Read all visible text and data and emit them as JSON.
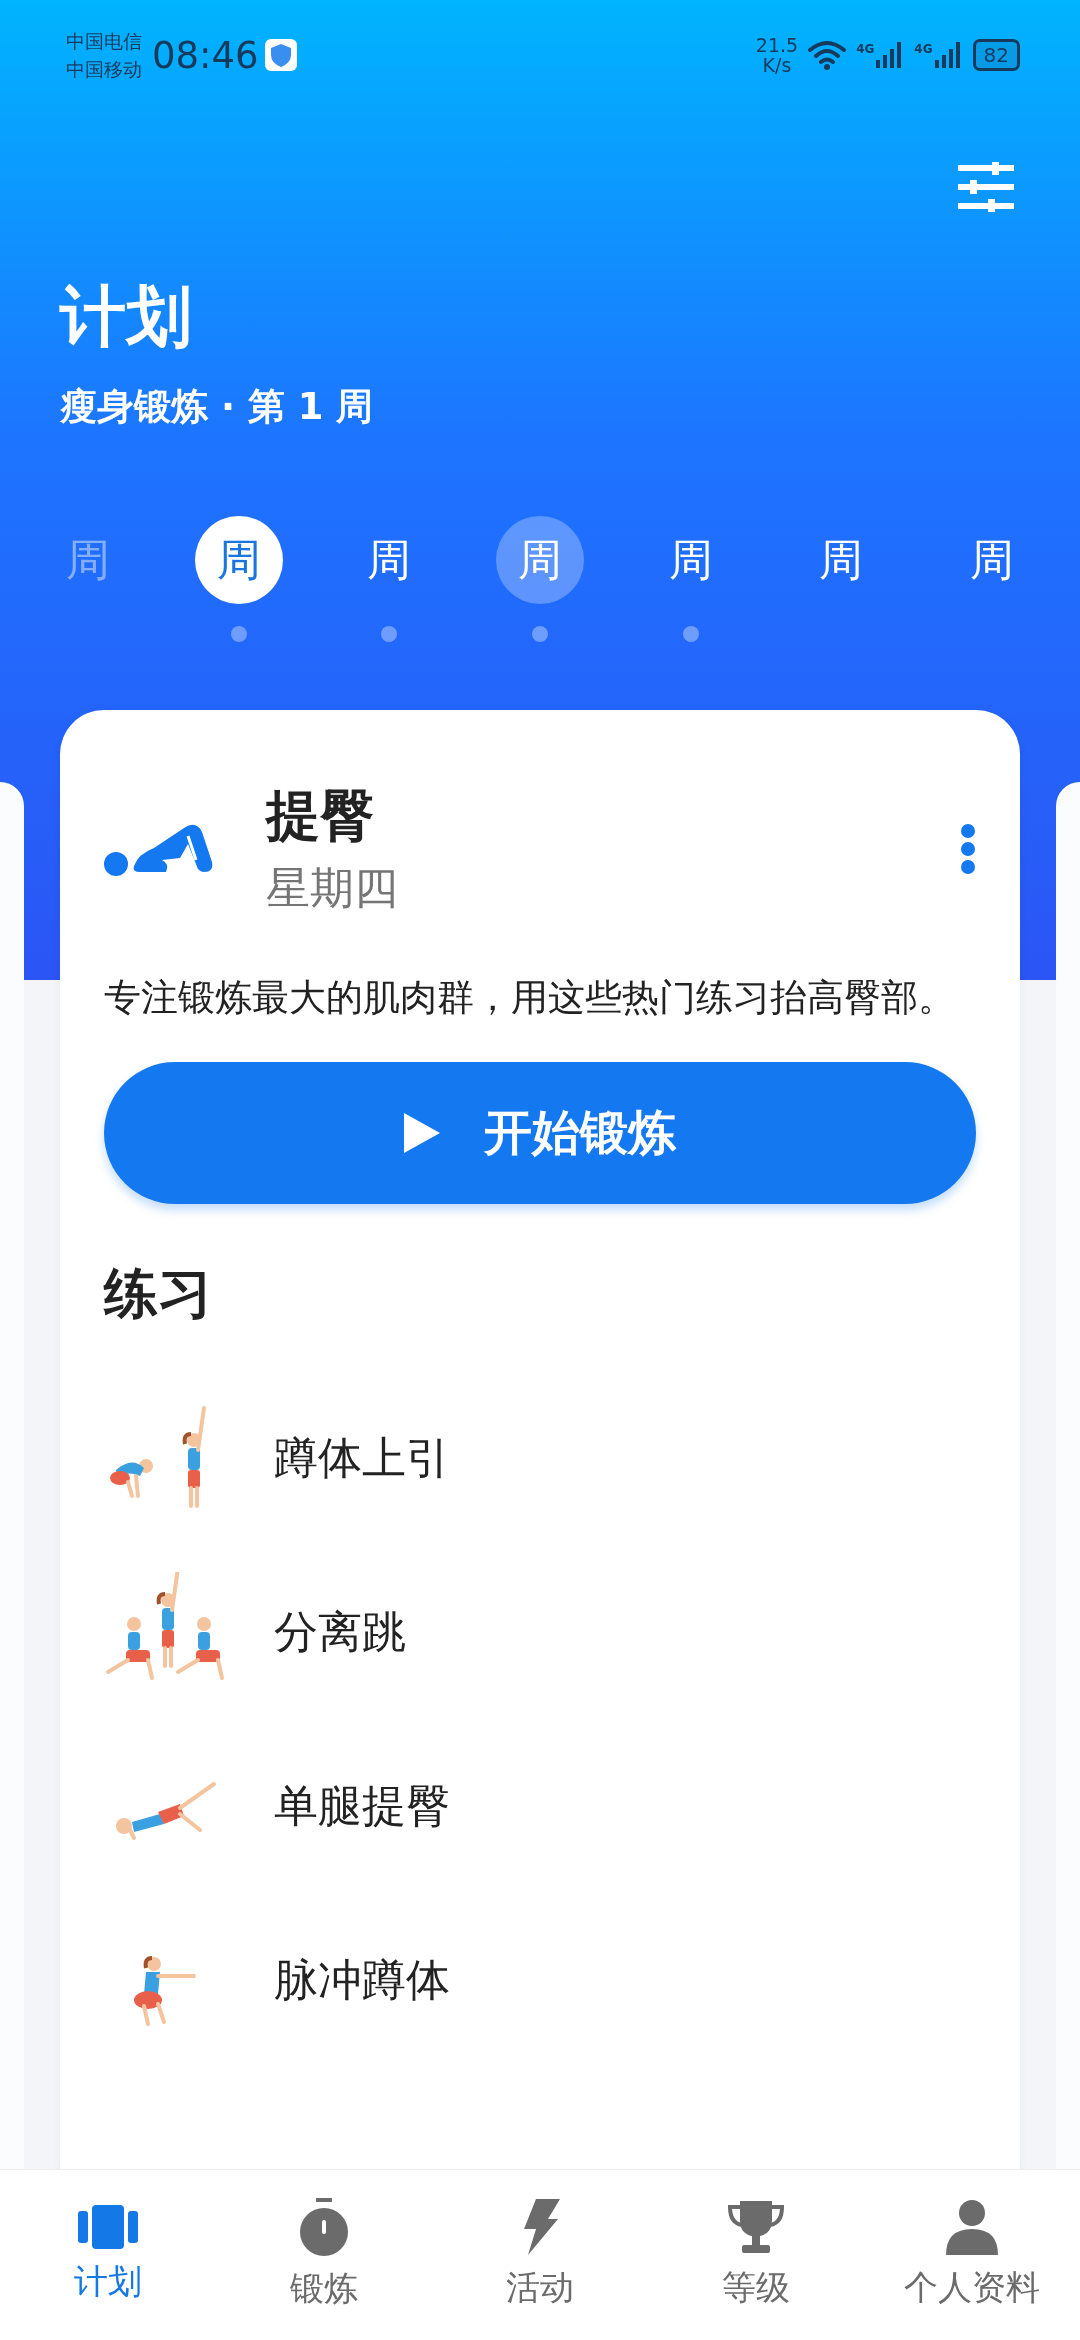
{
  "status_bar": {
    "carriers": [
      "中国电信",
      "中国移动"
    ],
    "time": "08:46",
    "net_speed": "21.5",
    "net_unit": "K/s",
    "signals": [
      "4G",
      "4G"
    ],
    "battery": "82"
  },
  "header": {
    "title": "计划",
    "subtitle": "瘦身锻炼 · 第 1 周"
  },
  "week_days": [
    {
      "label": "周",
      "selected": false,
      "today": false,
      "dimmed": true,
      "dot": false
    },
    {
      "label": "周",
      "selected": true,
      "today": false,
      "dimmed": false,
      "dot": true
    },
    {
      "label": "周",
      "selected": false,
      "today": false,
      "dimmed": false,
      "dot": true
    },
    {
      "label": "周",
      "selected": false,
      "today": true,
      "dimmed": false,
      "dot": true
    },
    {
      "label": "周",
      "selected": false,
      "today": false,
      "dimmed": false,
      "dot": true
    },
    {
      "label": "周",
      "selected": false,
      "today": false,
      "dimmed": false,
      "dot": false
    },
    {
      "label": "周",
      "selected": false,
      "today": false,
      "dimmed": false,
      "dot": false
    }
  ],
  "workout": {
    "title": "提臀",
    "day": "星期四",
    "description": "专注锻炼最大的肌肉群，用这些热门练习抬高臀部。",
    "start_button": "开始锻炼",
    "section_title": "练习",
    "exercises": [
      {
        "name": "蹲体上引",
        "kind": "squat-reach"
      },
      {
        "name": "分离跳",
        "kind": "lunge-jump"
      },
      {
        "name": "单腿提臀",
        "kind": "bridge"
      },
      {
        "name": "脉冲蹲体",
        "kind": "squat"
      }
    ]
  },
  "nav": [
    {
      "label": "计划",
      "kind": "plan",
      "selected": true
    },
    {
      "label": "锻炼",
      "kind": "timer",
      "selected": false
    },
    {
      "label": "活动",
      "kind": "bolt",
      "selected": false
    },
    {
      "label": "等级",
      "kind": "trophy",
      "selected": false
    },
    {
      "label": "个人资料",
      "kind": "person",
      "selected": false
    }
  ]
}
